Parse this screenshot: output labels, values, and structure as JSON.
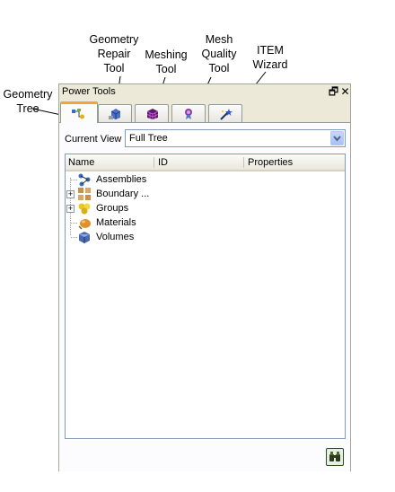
{
  "callouts": {
    "geometry_tree": [
      "Geometry",
      "Tree"
    ],
    "geometry_repair_tool": [
      "Geometry",
      "Repair",
      "Tool"
    ],
    "meshing_tool": [
      "Meshing",
      "Tool"
    ],
    "mesh_quality_tool": [
      "Mesh",
      "Quality",
      "Tool"
    ],
    "item_wizard": [
      "ITEM",
      "Wizard"
    ]
  },
  "panel": {
    "title": "Power Tools",
    "restore_glyph": "🗗",
    "close_glyph": "✕",
    "tabs": [
      {
        "icon": "geometry-tree-icon"
      },
      {
        "icon": "geometry-repair-icon"
      },
      {
        "icon": "meshing-icon"
      },
      {
        "icon": "mesh-quality-icon"
      },
      {
        "icon": "item-wizard-icon"
      }
    ],
    "current_view_label": "Current View",
    "current_view_value": "Full Tree",
    "columns": [
      "Name",
      "ID",
      "Properties"
    ],
    "tree_items": [
      {
        "label": "Assemblies",
        "icon": "assemblies-icon",
        "expandable": false
      },
      {
        "label": "Boundary ...",
        "icon": "boundary-conditions-icon",
        "expandable": true
      },
      {
        "label": "Groups",
        "icon": "groups-icon",
        "expandable": true
      },
      {
        "label": "Materials",
        "icon": "materials-icon",
        "expandable": false
      },
      {
        "label": "Volumes",
        "icon": "volumes-icon",
        "expandable": false
      }
    ],
    "expander_glyph": "+",
    "bottom_button_icon": "binoculars-icon"
  },
  "colors": {
    "panel_bg": "#ece9d8",
    "active_tab_accent": "#f0a43b",
    "field_border": "#7f9db9"
  }
}
